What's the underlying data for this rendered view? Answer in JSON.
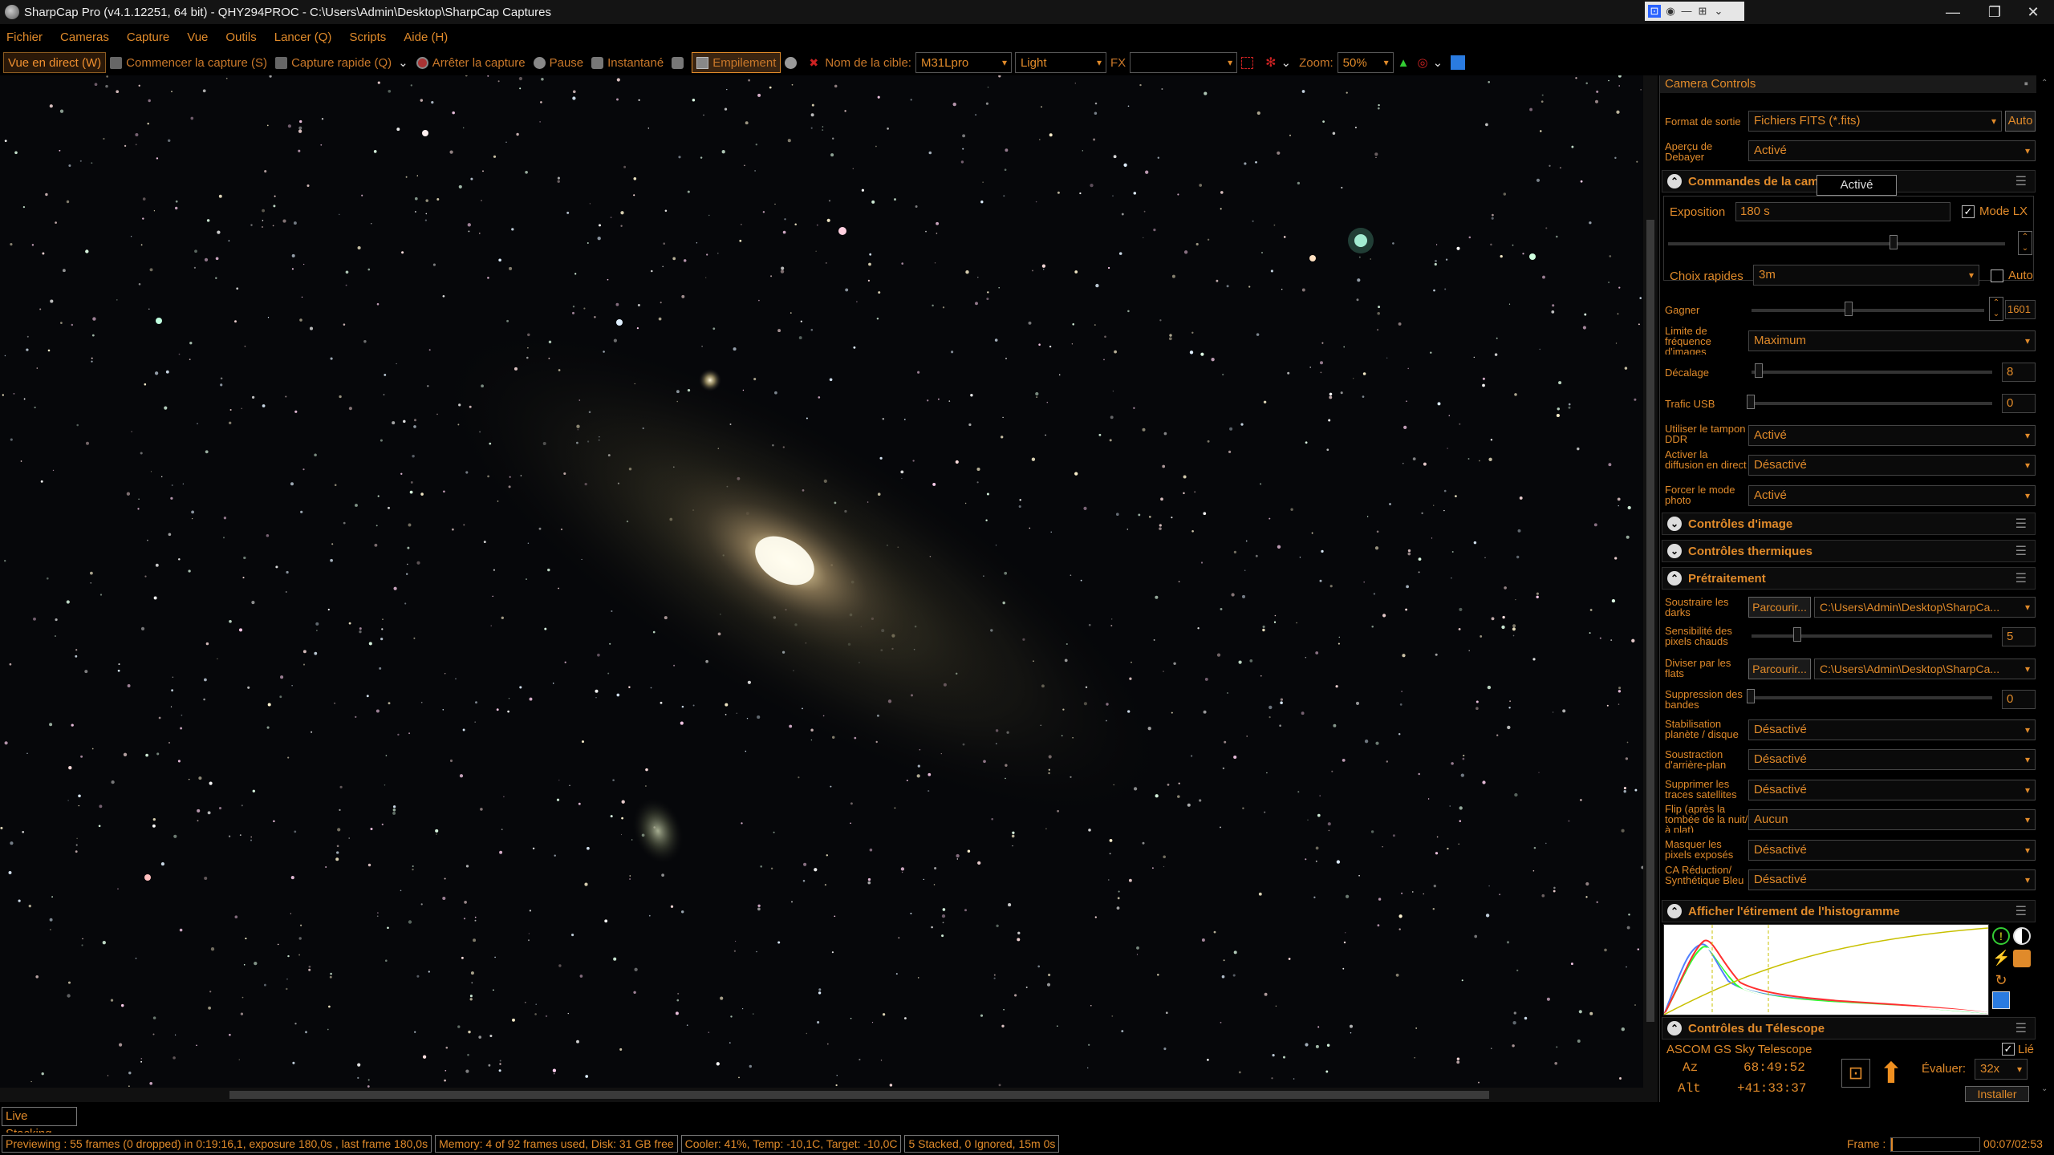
{
  "titlebar": {
    "title": "SharpCap Pro (v4.1.12251, 64 bit) - QHY294PROC - C:\\Users\\Admin\\Desktop\\SharpCap Captures",
    "minimize": "—",
    "maximize": "❐",
    "close": "✕"
  },
  "menubar": {
    "items": [
      "Fichier",
      "Cameras",
      "Capture",
      "Vue",
      "Outils",
      "Lancer (Q)",
      "Scripts",
      "Aide (H)"
    ]
  },
  "toolbar": {
    "live_view": "Vue en direct (W)",
    "start_capture": "Commencer la capture (S)",
    "quick_capture": "Capture rapide (Q)",
    "stop_capture": "Arrêter la capture",
    "pause": "Pause",
    "snapshot": "Instantané",
    "stacking": "Empilement",
    "target_label": "Nom de la cible:",
    "target_value": "M31Lpro",
    "frame_type": "Light",
    "fx_label": "FX",
    "zoom_label": "Zoom:",
    "zoom_value": "50%"
  },
  "panel": {
    "title": "Camera Controls",
    "output_format_label": "Format de sortie",
    "output_format_value": "Fichiers FITS (*.fits)",
    "auto_btn": "Auto",
    "debayer_label": "Aperçu de Debayer",
    "debayer_value": "Activé",
    "sec_camera": "Commandes de la cam",
    "tooltip": "Activé",
    "exposure_label": "Exposition",
    "exposure_value": "180 s",
    "lx_label": "Mode LX",
    "quick_label": "Choix rapides",
    "quick_value": "3m",
    "quick_auto": "Auto",
    "gain_label": "Gagner",
    "gain_value": "1601",
    "framerate_label": "Limite de fréquence d'images",
    "framerate_value": "Maximum",
    "offset_label": "Décalage",
    "offset_value": "8",
    "usb_label": "Trafic USB",
    "usb_value": "0",
    "ddr_label": "Utiliser le tampon DDR",
    "ddr_value": "Activé",
    "stream_label": "Activer la diffusion en direct",
    "stream_value": "Désactivé",
    "photo_label": "Forcer le mode photo",
    "photo_value": "Activé",
    "sec_image": "Contrôles d'image",
    "sec_thermal": "Contrôles thermiques",
    "sec_preproc": "Prétraitement",
    "darks_label": "Soustraire les darks",
    "browse": "Parcourir...",
    "darks_path": "C:\\Users\\Admin\\Desktop\\SharpCa...",
    "hot_label": "Sensibilité des pixels chauds",
    "hot_value": "5",
    "flats_label": "Diviser par les flats",
    "flats_path": "C:\\Users\\Admin\\Desktop\\SharpCa...",
    "banding_label": "Suppression des bandes",
    "banding_value": "0",
    "planet_label": "Stabilisation planète / disque",
    "planet_value": "Désactivé",
    "bg_label": "Soustraction d'arrière-plan",
    "bg_value": "Désactivé",
    "sat_label": "Supprimer les traces satellites",
    "sat_value": "Désactivé",
    "flip_label": "Flip (après la tombée de la nuit/à plat)",
    "flip_value": "Aucun",
    "mask_label": "Masquer les pixels exposés",
    "mask_value": "Désactivé",
    "ca_label": "CA Réduction/ Synthétique Bleu",
    "ca_value": "Désactivé",
    "sec_histo": "Afficher l'étirement de l'histogramme",
    "sec_scope": "Contrôles du Télescope",
    "scope_name": "ASCOM GS Sky Telescope",
    "scope_linked": "Lié",
    "az_label": "Az",
    "az_value": "68:49:52",
    "alt_label": "Alt",
    "alt_value": "+41:33:37",
    "rate_label": "Évaluer:",
    "rate_value": "32x",
    "install_btn": "Installer"
  },
  "footer_tab": "Live Stacking",
  "status": {
    "preview": "Previewing : 55 frames (0 dropped) in 0:19:16,1, exposure 180,0s , last frame 180,0s",
    "memory": "Memory: 4 of 92 frames used, Disk: 31 GB free",
    "cooler": "Cooler: 41%, Temp: -10,1C, Target: -10,0C",
    "stacked": "5 Stacked, 0 Ignored, 15m 0s",
    "frame_label": "Frame :",
    "frame_time": "00:07/02:53"
  },
  "colors": {
    "accent": "#e08a2a",
    "background": "#000000"
  },
  "histogram_data": {
    "type": "line",
    "series": [
      {
        "name": "red",
        "color": "#ff3030"
      },
      {
        "name": "green",
        "color": "#30ff30"
      },
      {
        "name": "blue",
        "color": "#5080ff"
      },
      {
        "name": "luminance",
        "color": "#ffffff"
      }
    ]
  }
}
